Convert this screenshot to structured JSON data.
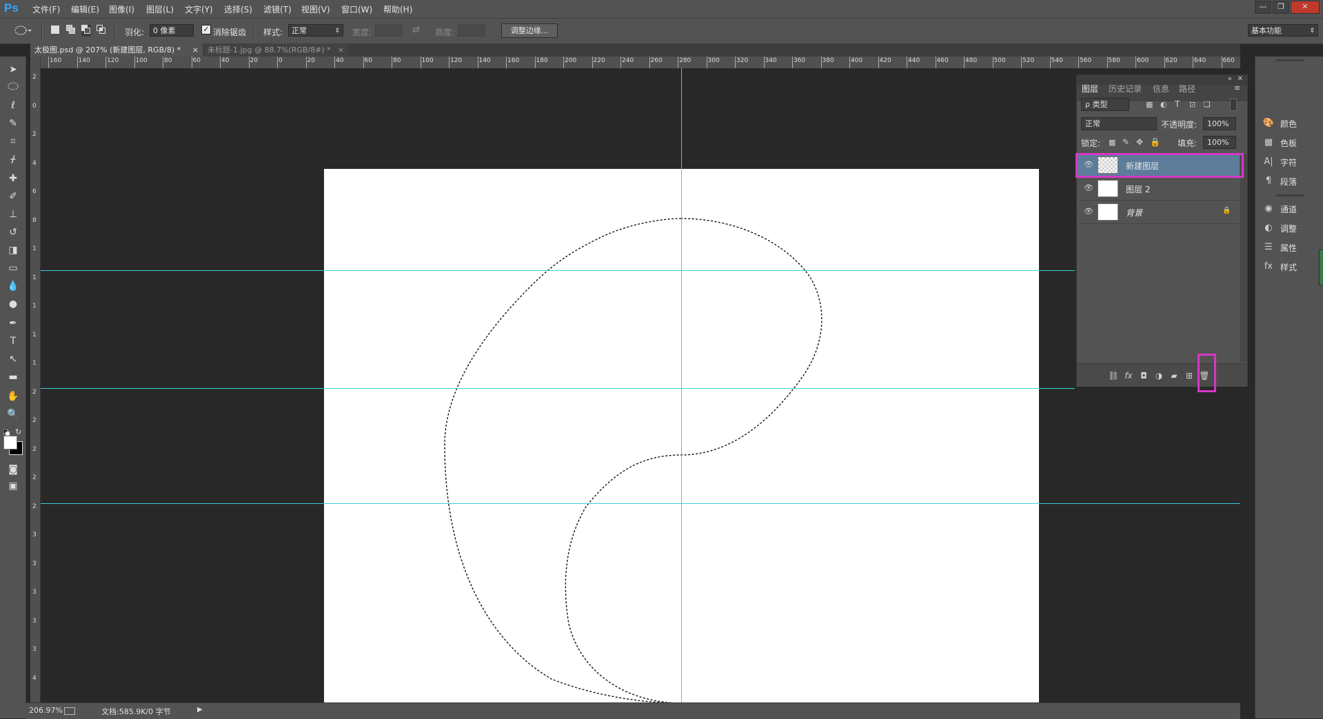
{
  "app": {
    "logo": "Ps"
  },
  "menu": [
    "文件(F)",
    "编辑(E)",
    "图像(I)",
    "图层(L)",
    "文字(Y)",
    "选择(S)",
    "滤镜(T)",
    "视图(V)",
    "窗口(W)",
    "帮助(H)"
  ],
  "window_controls": {
    "minimize": "—",
    "restore": "❐",
    "close": "✕"
  },
  "options": {
    "feather_label": "羽化:",
    "feather_value": "0 像素",
    "antialias_label": "消除锯齿",
    "antialias_checked": true,
    "style_label": "样式:",
    "style_value": "正常",
    "width_label": "宽度:",
    "height_label": "高度:",
    "refine_edge_button": "调整边缘...",
    "workspace": "基本功能"
  },
  "tabs": [
    {
      "label": "太极图.psd @ 207% (新建图层, RGB/8) *",
      "close": "×",
      "active": true
    },
    {
      "label": "未标题-1.jpg @ 88.7%(RGB/8#) *",
      "close": "×",
      "active": false
    }
  ],
  "ruler": {
    "h_labels": [
      "160",
      "140",
      "120",
      "100",
      "80",
      "60",
      "40",
      "20",
      "0",
      "20",
      "40",
      "60",
      "80",
      "100",
      "120",
      "140",
      "160",
      "180",
      "200",
      "220",
      "240",
      "260",
      "280",
      "300",
      "320",
      "340",
      "360",
      "380",
      "400",
      "420",
      "440",
      "460",
      "480",
      "500",
      "520",
      "540",
      "560",
      "580",
      "600",
      "620",
      "640",
      "660"
    ],
    "v_labels": [
      "2",
      "0",
      "2",
      "4",
      "6",
      "8",
      "1",
      "1",
      "1",
      "1",
      "1",
      "2",
      "2",
      "2",
      "2",
      "2",
      "3",
      "3",
      "3",
      "3",
      "3",
      "4"
    ]
  },
  "status": {
    "zoom": "206.97%",
    "doc_info": "文档:585.9K/0 字节"
  },
  "right_dock": [
    {
      "icon": "color-icon",
      "label": "颜色"
    },
    {
      "icon": "swatches-icon",
      "label": "色板"
    },
    {
      "icon": "character-icon",
      "label": "字符"
    },
    {
      "icon": "paragraph-icon",
      "label": "段落"
    },
    {
      "icon": "channels-icon",
      "label": "通道"
    },
    {
      "icon": "adjustments-icon",
      "label": "调整"
    },
    {
      "icon": "properties-icon",
      "label": "属性"
    },
    {
      "icon": "styles-icon",
      "label": "样式"
    }
  ],
  "layers_panel": {
    "tabs": [
      "图层",
      "历史记录",
      "信息",
      "路径"
    ],
    "filter_kind": "ρ 类型",
    "blend_mode": "正常",
    "opacity_label": "不透明度:",
    "opacity_value": "100%",
    "lock_label": "锁定:",
    "fill_label": "填充:",
    "fill_value": "100%",
    "layers": [
      {
        "name": "新建图层",
        "selected": true,
        "transparent": true,
        "locked": false
      },
      {
        "name": "图层 2",
        "selected": false,
        "transparent": false,
        "locked": false
      },
      {
        "name": "背景",
        "selected": false,
        "transparent": false,
        "locked": true
      }
    ]
  },
  "colors": {
    "guide": "#34d3d9",
    "highlight": "#d637c8",
    "selected_layer": "#5c7c99"
  }
}
